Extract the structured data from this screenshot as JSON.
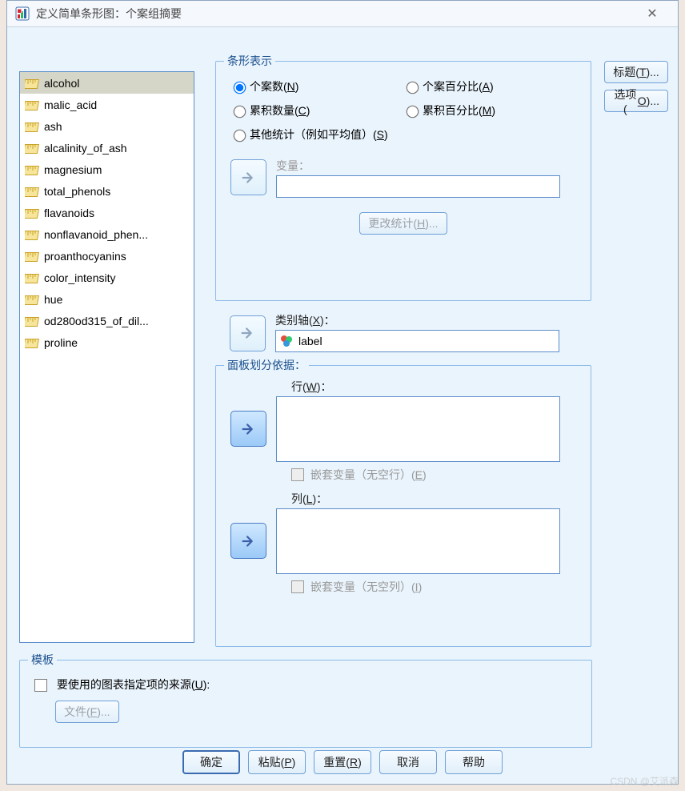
{
  "window": {
    "title": "定义简单条形图：个案组摘要"
  },
  "variables": [
    "alcohol",
    "malic_acid",
    "ash",
    "alcalinity_of_ash",
    "magnesium",
    "total_phenols",
    "flavanoids",
    "nonflavanoid_phen...",
    "proanthocyanins",
    "color_intensity",
    "hue",
    "od280od315_of_dil...",
    "proline"
  ],
  "bar": {
    "legend": "条形表示",
    "radios": {
      "ncases": {
        "pre": "个案数(",
        "m": "N",
        "post": ")"
      },
      "pctcases": {
        "pre": "个案百分比(",
        "m": "A",
        "post": ")"
      },
      "cumn": {
        "pre": "累积数量(",
        "m": "C",
        "post": ")"
      },
      "cumpct": {
        "pre": "累积百分比(",
        "m": "M",
        "post": ")"
      },
      "other": {
        "pre": "其他统计（例如平均值）(",
        "m": "S",
        "post": ")"
      }
    },
    "var_label": "变量：",
    "change": {
      "pre": "更改统计(",
      "m": "H",
      "post": ")..."
    }
  },
  "axis": {
    "label": {
      "pre": "类别轴(",
      "m": "X",
      "post": ")："
    },
    "value": "label"
  },
  "panel": {
    "legend": "面板划分依据：",
    "row": {
      "pre": "行(",
      "m": "W",
      "post": ")："
    },
    "nestrow": {
      "pre": "嵌套变量（无空行）(",
      "m": "E",
      "post": ")"
    },
    "col": {
      "pre": "列(",
      "m": "L",
      "post": ")："
    },
    "nestcol": {
      "pre": "嵌套变量（无空列）(",
      "m": "I",
      "post": ")"
    }
  },
  "template": {
    "legend": "模板",
    "use": {
      "pre": "要使用的图表指定项的来源(",
      "m": "U",
      "post": "):"
    },
    "file": {
      "pre": "文件(",
      "m": "F",
      "post": ")..."
    }
  },
  "side": {
    "title": {
      "pre": "标题(",
      "m": "T",
      "post": ")..."
    },
    "option": {
      "pre": "选项(",
      "m": "O",
      "post": ")..."
    }
  },
  "buttons": {
    "ok": "确定",
    "paste": {
      "pre": "粘贴(",
      "m": "P",
      "post": ")"
    },
    "reset": {
      "pre": "重置(",
      "m": "R",
      "post": ")"
    },
    "cancel": "取消",
    "help": "帮助"
  },
  "watermark": "CSDN @艾派森"
}
